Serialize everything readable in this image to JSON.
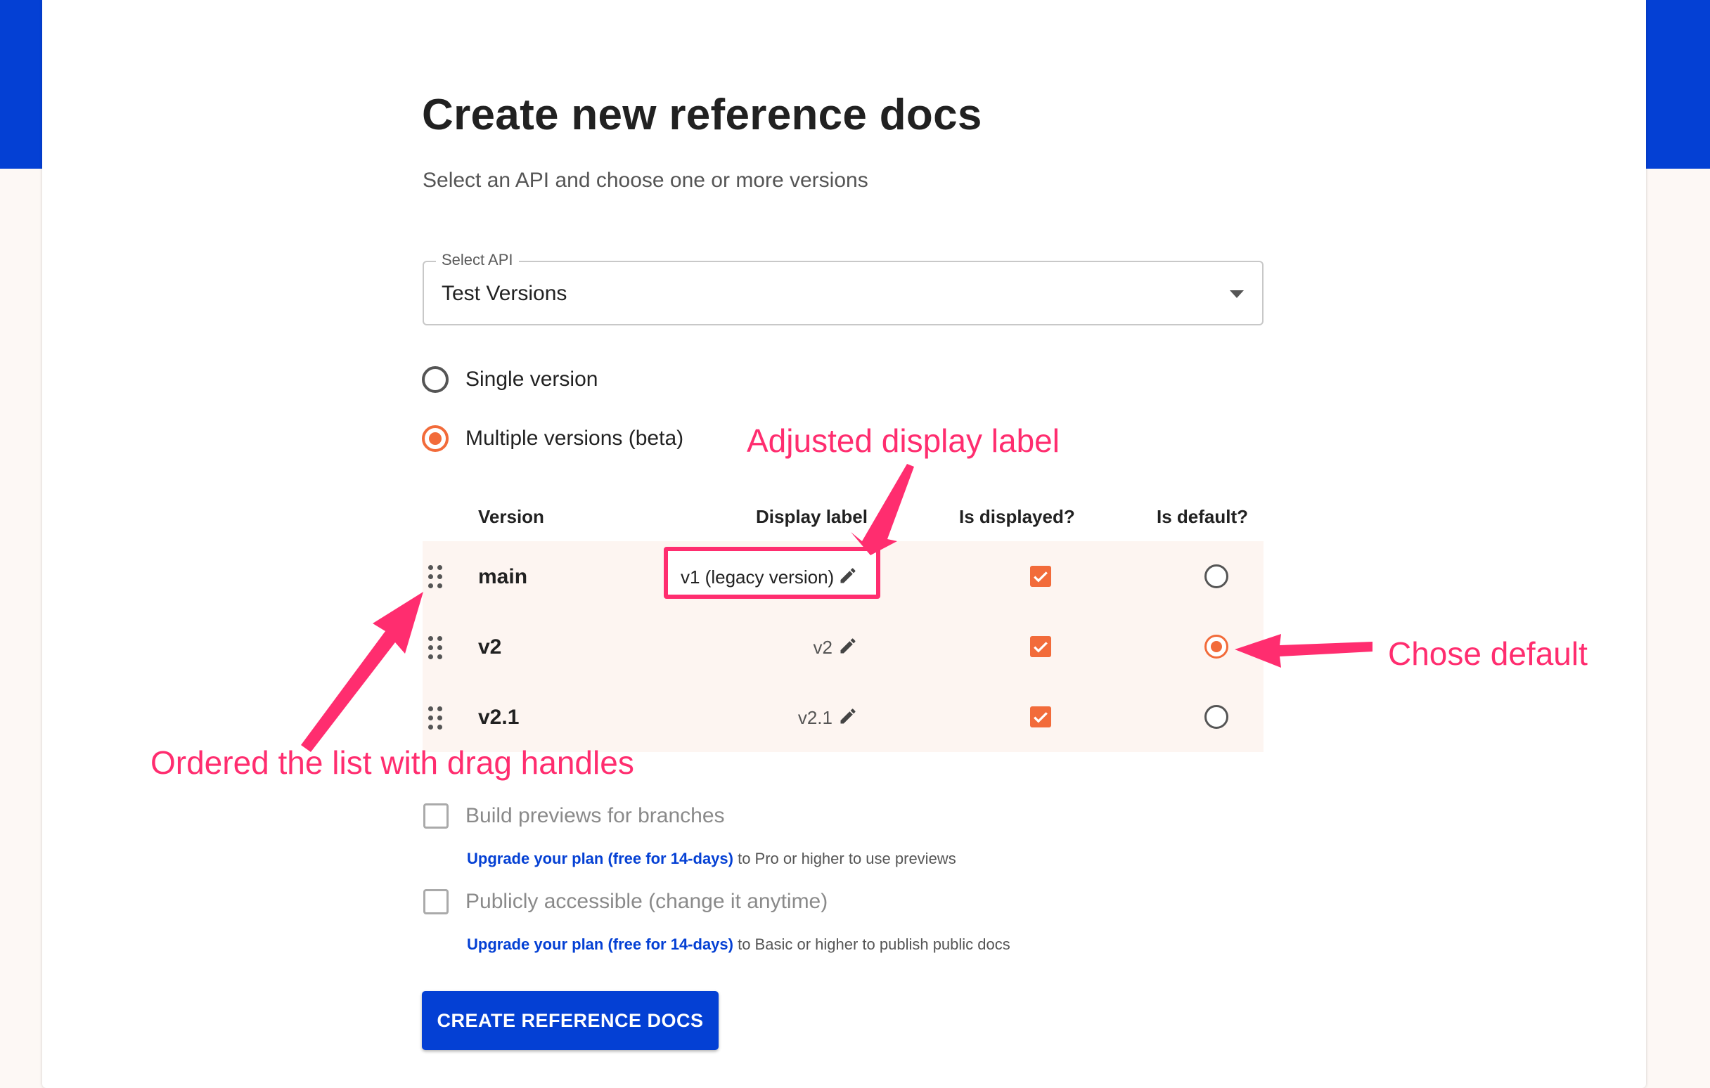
{
  "page": {
    "title": "Create new reference docs",
    "subtitle": "Select an API and choose one or more versions"
  },
  "select_api": {
    "label": "Select API",
    "value": "Test Versions"
  },
  "mode": {
    "single_label": "Single version",
    "multiple_label": "Multiple versions (beta)",
    "selected": "multiple"
  },
  "table": {
    "headers": {
      "version": "Version",
      "display_label": "Display label",
      "is_displayed": "Is displayed?",
      "is_default": "Is default?"
    },
    "rows": [
      {
        "version": "main",
        "display_label": "v1 (legacy version)",
        "is_displayed": true,
        "is_default": false
      },
      {
        "version": "v2",
        "display_label": "v2",
        "is_displayed": true,
        "is_default": true
      },
      {
        "version": "v2.1",
        "display_label": "v2.1",
        "is_displayed": true,
        "is_default": false
      }
    ]
  },
  "options": {
    "previews": {
      "label": "Build previews for branches",
      "link": "Upgrade your plan (free for 14-days)",
      "note": " to Pro or higher to use previews",
      "checked": false
    },
    "public": {
      "label": "Publicly accessible (change it anytime)",
      "link": "Upgrade your plan (free for 14-days)",
      "note": " to Basic or higher to publish public docs",
      "checked": false
    }
  },
  "create_button": "CREATE REFERENCE DOCS",
  "annotations": {
    "display_label": "Adjusted display label",
    "default": "Chose default",
    "drag": "Ordered the list with drag handles"
  },
  "colors": {
    "brand_blue": "#0440d4",
    "accent_orange": "#f26b3a",
    "annotation_pink": "#ff2d6f"
  },
  "icons": [
    "chevron-down-icon",
    "drag-handle-icon",
    "pencil-icon",
    "checkmark-icon"
  ]
}
